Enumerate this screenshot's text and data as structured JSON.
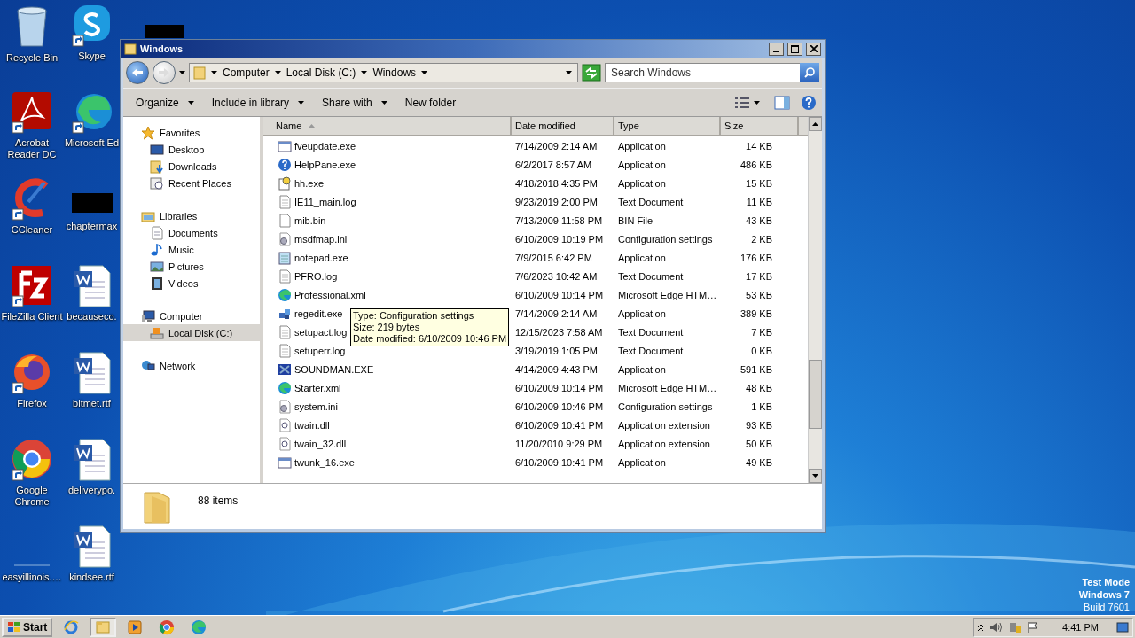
{
  "desktop_icons": [
    {
      "label": "Recycle Bin",
      "kind": "recycle"
    },
    {
      "label": "Acrobat Reader DC",
      "kind": "acrobat"
    },
    {
      "label": "CCleaner",
      "kind": "ccleaner"
    },
    {
      "label": "FileZilla Client",
      "kind": "filezilla"
    },
    {
      "label": "Firefox",
      "kind": "firefox"
    },
    {
      "label": "Google Chrome",
      "kind": "chrome"
    },
    {
      "label": "easyillinois.…",
      "kind": "blank"
    },
    {
      "label": "Skype",
      "kind": "skype"
    },
    {
      "label": "Microsoft Ed",
      "kind": "edge"
    },
    {
      "label": "chaptermax",
      "kind": "redacted"
    },
    {
      "label": "becauseco.",
      "kind": "word"
    },
    {
      "label": "bitmet.rtf",
      "kind": "word"
    },
    {
      "label": "deliverypo.",
      "kind": "word"
    },
    {
      "label": "kindsee.rtf",
      "kind": "word"
    }
  ],
  "window": {
    "title": "Windows",
    "breadcrumb": [
      "Computer",
      "Local Disk (C:)",
      "Windows"
    ],
    "search": {
      "placeholder": "Search Windows"
    },
    "toolbar": [
      {
        "label": "Organize",
        "menu": true
      },
      {
        "label": "Include in library",
        "menu": true
      },
      {
        "label": "Share with",
        "menu": true
      },
      {
        "label": "New folder",
        "menu": false
      }
    ],
    "sidebar": [
      {
        "label": "Favorites",
        "kind": "star",
        "selected": false,
        "children": [
          {
            "label": "Desktop",
            "kind": "desktop",
            "selected": false
          },
          {
            "label": "Downloads",
            "kind": "downloads",
            "selected": false
          },
          {
            "label": "Recent Places",
            "kind": "recent",
            "selected": false
          }
        ]
      },
      {
        "label": "Libraries",
        "kind": "libraries",
        "selected": false,
        "children": [
          {
            "label": "Documents",
            "kind": "documents",
            "selected": false
          },
          {
            "label": "Music",
            "kind": "music",
            "selected": false
          },
          {
            "label": "Pictures",
            "kind": "pictures",
            "selected": false
          },
          {
            "label": "Videos",
            "kind": "videos",
            "selected": false
          }
        ]
      },
      {
        "label": "Computer",
        "kind": "computer",
        "selected": false,
        "children": [
          {
            "label": "Local Disk (C:)",
            "kind": "disk",
            "selected": true
          }
        ]
      },
      {
        "label": "Network",
        "kind": "network",
        "selected": false
      }
    ],
    "columns": [
      {
        "label": "Name",
        "sorted": true
      },
      {
        "label": "Date modified",
        "sorted": false
      },
      {
        "label": "Type",
        "sorted": false
      },
      {
        "label": "Size",
        "sorted": false
      }
    ],
    "files": [
      {
        "name": "fveupdate.exe",
        "kind": "exe",
        "date": "7/14/2009 2:14 AM",
        "type": "Application",
        "size": "14 KB"
      },
      {
        "name": "HelpPane.exe",
        "kind": "help",
        "date": "6/2/2017 8:57 AM",
        "type": "Application",
        "size": "486 KB"
      },
      {
        "name": "hh.exe",
        "kind": "hh",
        "date": "4/18/2018 4:35 PM",
        "type": "Application",
        "size": "15 KB"
      },
      {
        "name": "IE11_main.log",
        "kind": "text",
        "date": "9/23/2019 2:00 PM",
        "type": "Text Document",
        "size": "11 KB"
      },
      {
        "name": "mib.bin",
        "kind": "blank",
        "date": "7/13/2009 11:58 PM",
        "type": "BIN File",
        "size": "43 KB"
      },
      {
        "name": "msdfmap.ini",
        "kind": "config",
        "date": "6/10/2009 10:19 PM",
        "type": "Configuration settings",
        "size": "2 KB"
      },
      {
        "name": "notepad.exe",
        "kind": "notepad",
        "date": "7/9/2015 6:42 PM",
        "type": "Application",
        "size": "176 KB"
      },
      {
        "name": "PFRO.log",
        "kind": "text",
        "date": "7/6/2023 10:42 AM",
        "type": "Text Document",
        "size": "17 KB"
      },
      {
        "name": "Professional.xml",
        "kind": "edge",
        "date": "6/10/2009 10:14 PM",
        "type": "Microsoft Edge HTM…",
        "size": "53 KB"
      },
      {
        "name": "regedit.exe",
        "kind": "regedit",
        "date": "7/14/2009 2:14 AM",
        "type": "Application",
        "size": "389 KB"
      },
      {
        "name": "setupact.log",
        "kind": "text",
        "date": "12/15/2023 7:58 AM",
        "type": "Text Document",
        "size": "7 KB"
      },
      {
        "name": "setuperr.log",
        "kind": "text",
        "date": "3/19/2019 1:05 PM",
        "type": "Text Document",
        "size": "0 KB"
      },
      {
        "name": "SOUNDMAN.EXE",
        "kind": "sound",
        "date": "4/14/2009 4:43 PM",
        "type": "Application",
        "size": "591 KB"
      },
      {
        "name": "Starter.xml",
        "kind": "edge",
        "date": "6/10/2009 10:14 PM",
        "type": "Microsoft Edge HTM…",
        "size": "48 KB"
      },
      {
        "name": "system.ini",
        "kind": "config",
        "date": "6/10/2009 10:46 PM",
        "type": "Configuration settings",
        "size": "1 KB"
      },
      {
        "name": "twain.dll",
        "kind": "dll",
        "date": "6/10/2009 10:41 PM",
        "type": "Application extension",
        "size": "93 KB"
      },
      {
        "name": "twain_32.dll",
        "kind": "dll",
        "date": "11/20/2010 9:29 PM",
        "type": "Application extension",
        "size": "50 KB"
      },
      {
        "name": "twunk_16.exe",
        "kind": "exe",
        "date": "6/10/2009 10:41 PM",
        "type": "Application",
        "size": "49 KB"
      }
    ],
    "tooltip": [
      "Type: Configuration settings",
      "Size: 219 bytes",
      "Date modified: 6/10/2009 10:46 PM"
    ],
    "details": {
      "count": "88 items"
    }
  },
  "taskbar": {
    "start": "Start",
    "apps": [
      {
        "kind": "ie",
        "selected": false
      },
      {
        "kind": "explorer",
        "selected": true
      },
      {
        "kind": "media",
        "selected": false
      },
      {
        "kind": "chrome",
        "selected": false
      },
      {
        "kind": "edge",
        "selected": false
      }
    ],
    "clock": "4:41 PM"
  },
  "watermark_text": [
    "Test Mode",
    "Windows 7",
    "Build 7601"
  ]
}
